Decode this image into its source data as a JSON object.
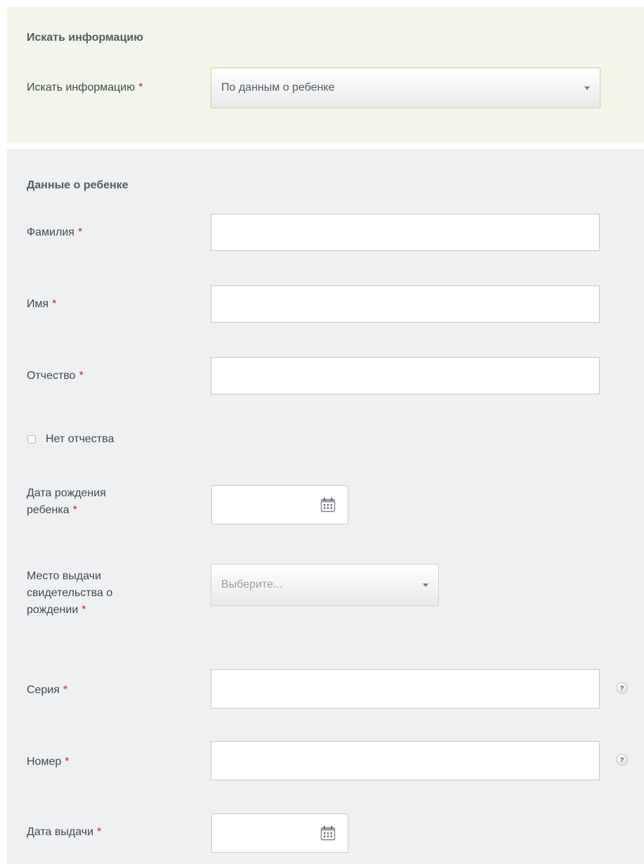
{
  "search_section": {
    "title": "Искать информацию",
    "field_label": "Искать информацию",
    "selected_value": "По данным о ребенке"
  },
  "child_section": {
    "title": "Данные о ребенке",
    "last_name": {
      "label": "Фамилия",
      "value": ""
    },
    "first_name": {
      "label": "Имя",
      "value": ""
    },
    "patronymic": {
      "label": "Отчество",
      "value": ""
    },
    "no_patronymic_label": "Нет отчества",
    "birth_date": {
      "label_line1": "Дата рождения",
      "label_line2": "ребенка",
      "value": ""
    },
    "certificate_place": {
      "label_line1": "Место выдачи",
      "label_line2": "свидетельства о",
      "label_line3": "рождении",
      "placeholder": "Выберите..."
    },
    "series": {
      "label": "Серия",
      "value": ""
    },
    "number": {
      "label": "Номер",
      "value": ""
    },
    "issue_date": {
      "label": "Дата выдачи",
      "value": ""
    }
  },
  "required_mark": "*",
  "help_mark": "?",
  "icons": {
    "dropdown": "chevron-down-icon",
    "calendar": "calendar-icon",
    "help": "question-icon"
  },
  "colors": {
    "search_panel_bg": "#f2f5e9",
    "child_panel_bg": "#eef0f2",
    "required": "#cc2222"
  }
}
